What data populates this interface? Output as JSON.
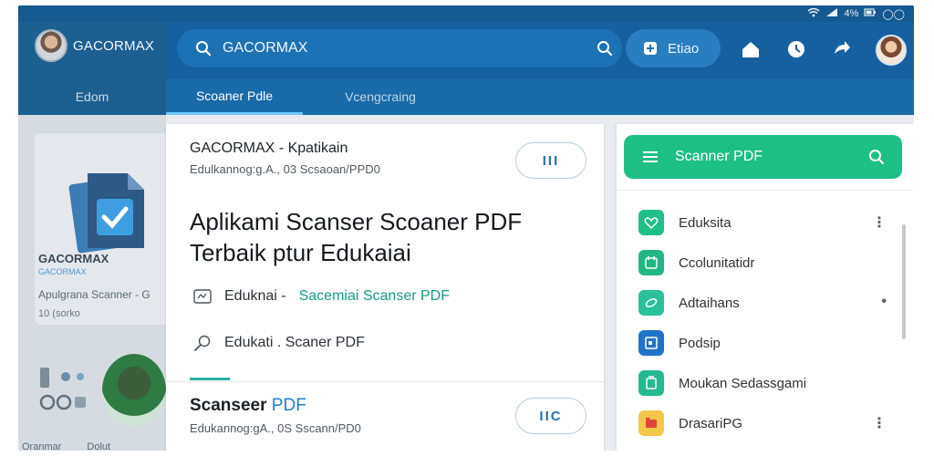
{
  "status": {
    "wifi": "wifi-icon",
    "signal": "signal-icon",
    "battery_text": "4%",
    "battery": "battery-icon",
    "extra": "◯◯"
  },
  "left": {
    "brand": "GACORMAX",
    "tab": "Edom",
    "card_title": "GACORMAX",
    "card_subtitle": "GACORMAX",
    "card_line1": "Apulgrana Scanner - G",
    "card_line2": "10 (sorko",
    "bottom_a": "Oranmar",
    "bottom_b": "Dolut"
  },
  "header": {
    "search_text": "GACORMAX",
    "pill_label": "Etiao",
    "tabs": [
      {
        "label": "Scoaner Pdle"
      },
      {
        "label": "Vcengcraing"
      }
    ]
  },
  "center": {
    "card1": {
      "title": "GACORMAX - Kpatikain",
      "subtitle": "Edulkannog:g.A., 03 Scsaoan/PPD0",
      "button": "III"
    },
    "headline": "Aplikami Scanser Scoaner PDF Terbaik ptur Edukaiai",
    "row1_label": "Eduknai -",
    "row1_link": "Sacemiai Scanser PDF",
    "row2_label": "Edukati . Scaner PDF",
    "card2": {
      "title": "Scanseer",
      "title_accent": "PDF",
      "subtitle": "Edukannog:gA., 0S Sscann/PD0",
      "button": "IIC"
    }
  },
  "right": {
    "title": "Scanner PDF",
    "items": [
      {
        "label": "Eduksita",
        "color": "#1fbf88",
        "icon": "heart-icon",
        "more": "⋮"
      },
      {
        "label": "Ccolunitatidr",
        "color": "#22b884",
        "icon": "calendar-icon",
        "more": ""
      },
      {
        "label": "Adtaihans",
        "color": "#2ac19a",
        "icon": "link-icon",
        "more": "•"
      },
      {
        "label": "Podsip",
        "color": "#1f74c9",
        "icon": "window-icon",
        "more": ""
      },
      {
        "label": "Moukan Sedassgami",
        "color": "#25b98f",
        "icon": "copy-icon",
        "more": ""
      },
      {
        "label": "DrasariPG",
        "color": "#f5c64a",
        "icon": "folder-icon",
        "more": "⋮"
      }
    ]
  }
}
